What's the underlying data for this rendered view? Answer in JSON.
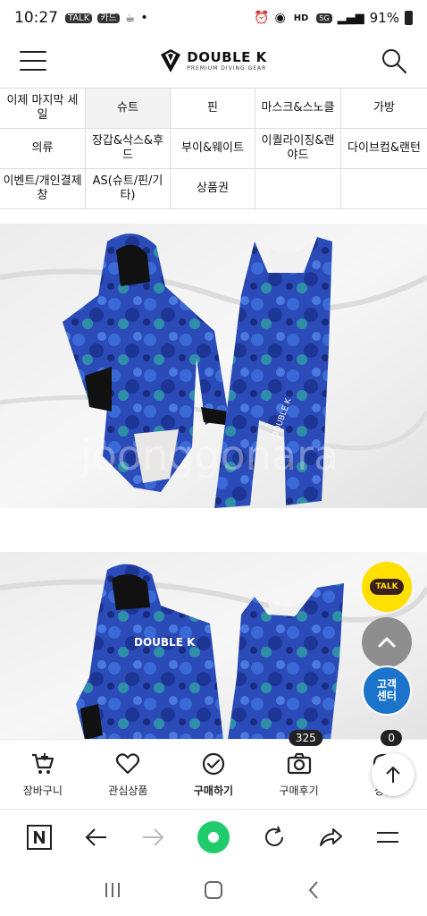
{
  "status_bar": {
    "time": "10:27",
    "notif_icons": [
      "TALK",
      "카드",
      "☕",
      "•"
    ],
    "hd_label": "HD",
    "network": "5G",
    "battery": "91%"
  },
  "header": {
    "brand_name": "DOUBLE K",
    "brand_tagline": "PREMIUM DIVING GEAR"
  },
  "categories": [
    {
      "label": "이제 마지막 세일",
      "active": false
    },
    {
      "label": "슈트",
      "active": true
    },
    {
      "label": "핀",
      "active": false
    },
    {
      "label": "마스크&스노클",
      "active": false
    },
    {
      "label": "가방",
      "active": false
    },
    {
      "label": "의류",
      "active": false
    },
    {
      "label": "장갑&삭스&후드",
      "active": false
    },
    {
      "label": "부이&웨이트",
      "active": false
    },
    {
      "label": "이퀄라이징&랜야드",
      "active": false
    },
    {
      "label": "다이브컴&랜턴",
      "active": false
    },
    {
      "label": "이벤트/개인결제창",
      "active": false
    },
    {
      "label": "AS(슈트/핀/기타)",
      "active": false
    },
    {
      "label": "상품권",
      "active": false
    },
    {
      "label": "",
      "active": false
    },
    {
      "label": "",
      "active": false
    }
  ],
  "photo1": {
    "watermark": "joonggonara",
    "jacket_brand": "DOUBLE K"
  },
  "photo2": {
    "jacket_brand": "DOUBLE K"
  },
  "floating": {
    "talk_label": "TALK",
    "cs_line1": "고객",
    "cs_line2": "센터"
  },
  "actions": [
    {
      "label": "장바구니",
      "icon": "cart-icon"
    },
    {
      "label": "관심상품",
      "icon": "heart-icon"
    },
    {
      "label": "구매하기",
      "icon": "check-circle-icon"
    },
    {
      "label": "구매후기",
      "icon": "camera-icon",
      "badge": "325"
    },
    {
      "label": "상품",
      "icon": "chat-icon",
      "badge": "0"
    }
  ],
  "colors": {
    "talk_yellow": "#ffe000",
    "cs_blue": "#1b74c9",
    "browser_green": "#1fcb6a",
    "suit_blue": "#2a4bb8"
  }
}
